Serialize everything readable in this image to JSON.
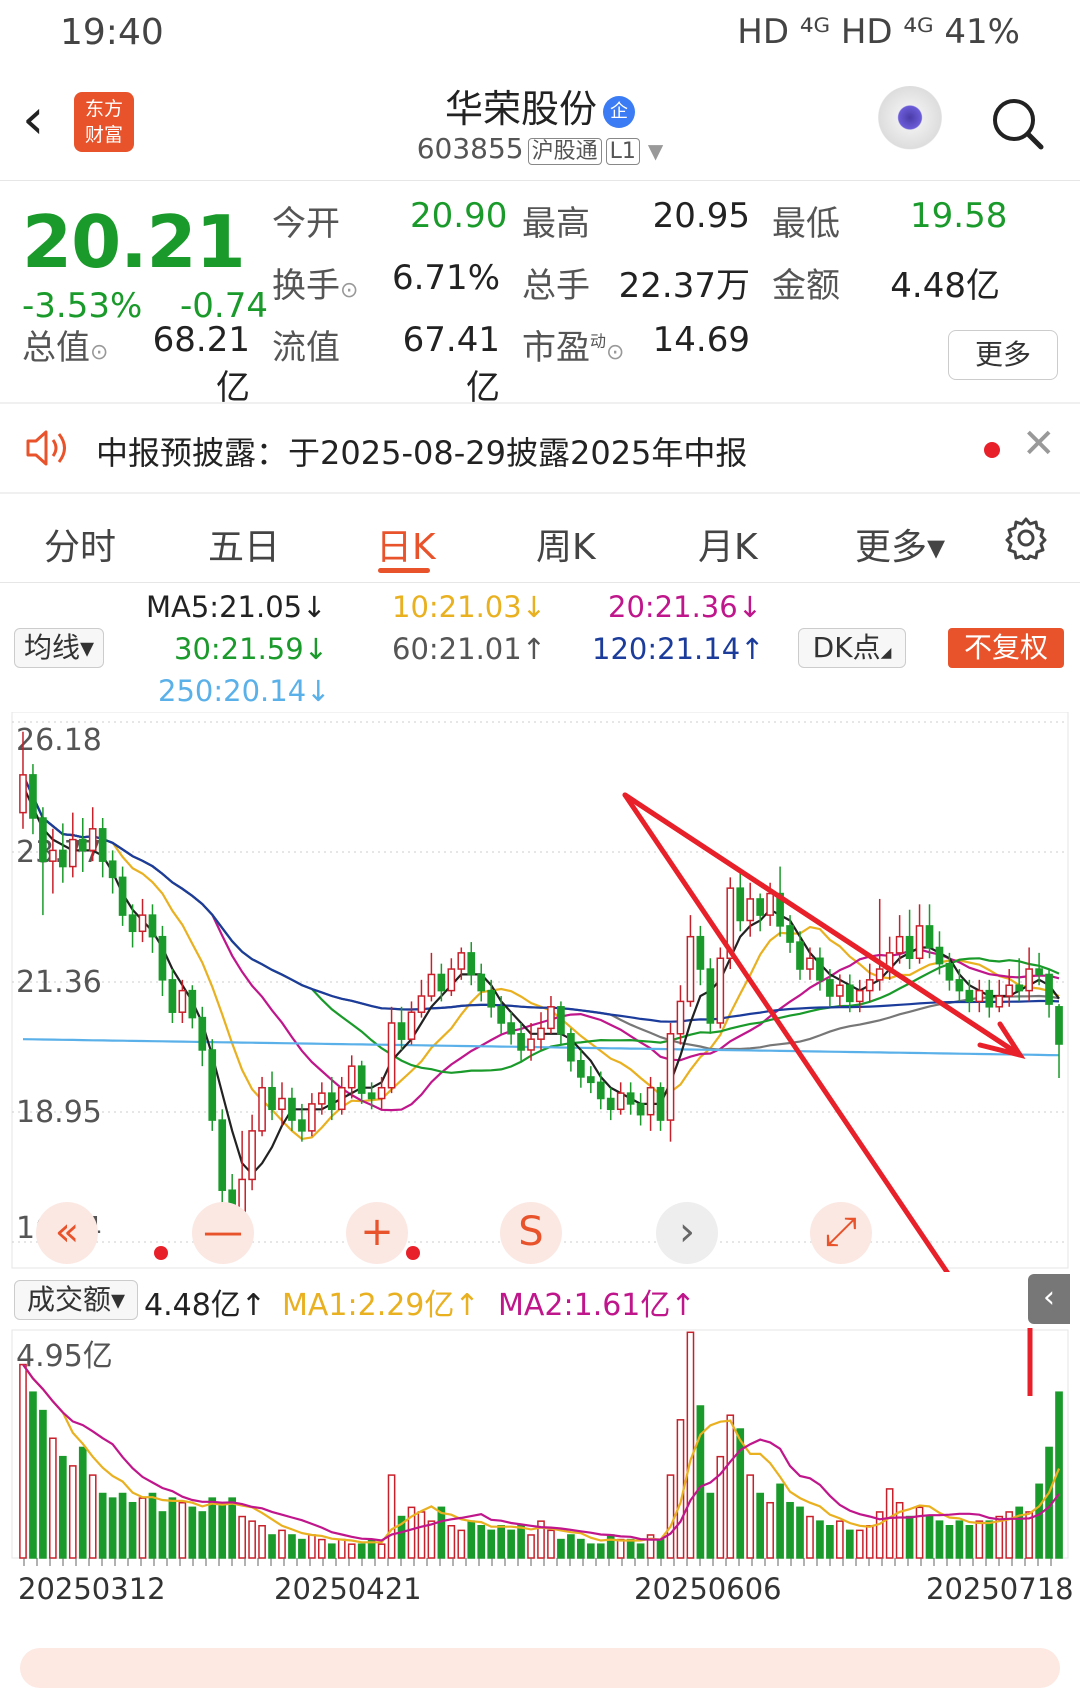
{
  "status_bar": {
    "time": "19:40",
    "right": "HD ⁴ᴳ HD ⁴ᴳ 41%"
  },
  "header": {
    "logo_text": "东方财富",
    "stock_name": "华荣股份",
    "enterprise_badge": "企",
    "code": "603855",
    "tag1": "沪股通",
    "tag2": "L1"
  },
  "quote": {
    "price": "20.21",
    "change_pct": "-3.53%",
    "change_amt": "-0.74",
    "open_label": "今开",
    "open": "20.90",
    "high_label": "最高",
    "high": "20.95",
    "low_label": "最低",
    "low": "19.58",
    "turnover_label": "换手",
    "turnover": "6.71%",
    "volume_label": "总手",
    "volume": "22.37万",
    "amount_label": "金额",
    "amount": "4.48亿",
    "mcap_label": "总值",
    "mcap": "68.21亿",
    "float_label": "流值",
    "float": "67.41亿",
    "pe_label": "市盈",
    "pe_sup": "动",
    "pe": "14.69",
    "more_button": "更多"
  },
  "notice": {
    "text": "中报预披露：于2025-08-29披露2025年中报"
  },
  "tabs": [
    "分时",
    "五日",
    "日K",
    "周K",
    "月K",
    "更多▾"
  ],
  "active_tab": "日K",
  "ma_legend": {
    "selector": "均线▾",
    "ma5": "MA5:21.05↓",
    "ma10": "10:21.03↓",
    "ma20": "20:21.36↓",
    "ma30": "30:21.59↓",
    "ma60": "60:21.01↑",
    "ma120": "120:21.14↑",
    "ma250": "250:20.14↓",
    "dk_button": "DK点",
    "fq_button": "不复权"
  },
  "colors": {
    "up": "#c8202a",
    "down": "#1a9a2a",
    "accent": "#e8532b",
    "ma5": "#222222",
    "ma10": "#e9b020",
    "ma20": "#c0168c",
    "ma30": "#1a9a2a",
    "ma60": "#777777",
    "ma120": "#1c3c9c",
    "ma250": "#5ab0e8"
  },
  "price_axis": {
    "labels": [
      "26.18",
      "23.77",
      "21.36",
      "18.95",
      "16.54"
    ]
  },
  "controls": [
    "«",
    "—",
    "+",
    "S",
    "›",
    "⤢"
  ],
  "volume_legend": {
    "selector": "成交额▾",
    "value": "4.48亿↑",
    "ma1": "MA1:2.29亿↑",
    "ma2": "MA2:1.61亿↑",
    "axis_label": "4.95亿"
  },
  "dates": [
    "20250312",
    "20250421",
    "20250606",
    "20250718"
  ],
  "chart_data": {
    "type": "candlestick",
    "ylim": [
      16.54,
      26.18
    ],
    "volume_ylim": [
      0,
      4.95
    ],
    "candles": [
      [
        24.5,
        25.2,
        26.0,
        24.2
      ],
      [
        25.2,
        24.4,
        25.4,
        24.1
      ],
      [
        24.4,
        23.6,
        24.6,
        22.6
      ],
      [
        23.6,
        23.8,
        24.2,
        23.0
      ],
      [
        23.8,
        23.5,
        24.3,
        23.2
      ],
      [
        23.5,
        24.0,
        24.5,
        23.3
      ],
      [
        24.0,
        23.8,
        24.4,
        23.4
      ],
      [
        23.8,
        24.2,
        24.6,
        23.6
      ],
      [
        24.2,
        23.6,
        24.4,
        23.3
      ],
      [
        23.6,
        23.3,
        23.8,
        23.0
      ],
      [
        23.3,
        22.6,
        23.5,
        22.4
      ],
      [
        22.6,
        22.3,
        22.8,
        22.0
      ],
      [
        22.3,
        22.6,
        22.9,
        22.1
      ],
      [
        22.6,
        22.2,
        22.8,
        21.9
      ],
      [
        22.2,
        21.4,
        22.4,
        21.1
      ],
      [
        21.4,
        20.8,
        21.6,
        20.6
      ],
      [
        20.8,
        21.2,
        21.4,
        20.6
      ],
      [
        21.2,
        20.7,
        21.3,
        20.5
      ],
      [
        20.7,
        20.1,
        20.9,
        19.8
      ],
      [
        20.1,
        18.8,
        20.3,
        18.6
      ],
      [
        18.8,
        17.5,
        19.0,
        17.2
      ],
      [
        17.5,
        16.9,
        17.8,
        16.54
      ],
      [
        16.9,
        17.7,
        18.6,
        16.54
      ],
      [
        17.7,
        18.6,
        18.9,
        17.5
      ],
      [
        18.6,
        19.4,
        19.6,
        18.5
      ],
      [
        19.4,
        19.0,
        19.7,
        18.8
      ],
      [
        19.0,
        19.2,
        19.5,
        18.7
      ],
      [
        19.2,
        18.8,
        19.4,
        18.6
      ],
      [
        18.8,
        18.6,
        19.1,
        18.4
      ],
      [
        18.6,
        19.1,
        19.3,
        18.5
      ],
      [
        19.1,
        19.3,
        19.5,
        18.9
      ],
      [
        19.3,
        19.0,
        19.6,
        18.8
      ],
      [
        19.0,
        19.4,
        19.6,
        18.9
      ],
      [
        19.4,
        19.8,
        20.0,
        19.2
      ],
      [
        19.8,
        19.3,
        19.9,
        19.1
      ],
      [
        19.3,
        19.2,
        19.5,
        19.0
      ],
      [
        19.2,
        19.4,
        19.6,
        19.0
      ],
      [
        19.4,
        20.6,
        20.9,
        19.3
      ],
      [
        20.6,
        20.3,
        20.9,
        20.1
      ],
      [
        20.3,
        20.8,
        21.0,
        20.2
      ],
      [
        20.8,
        21.1,
        21.4,
        20.7
      ],
      [
        21.1,
        21.5,
        21.9,
        21.0
      ],
      [
        21.5,
        21.2,
        21.7,
        21.0
      ],
      [
        21.2,
        21.6,
        21.8,
        21.1
      ],
      [
        21.6,
        21.9,
        22.0,
        21.4
      ],
      [
        21.9,
        21.5,
        22.1,
        21.3
      ],
      [
        21.5,
        21.2,
        21.7,
        21.0
      ],
      [
        21.2,
        20.9,
        21.4,
        20.7
      ],
      [
        20.9,
        20.6,
        21.1,
        20.4
      ],
      [
        20.6,
        20.4,
        20.8,
        20.2
      ],
      [
        20.4,
        20.1,
        20.6,
        19.9
      ],
      [
        20.1,
        20.3,
        20.6,
        19.9
      ],
      [
        20.3,
        20.5,
        20.8,
        20.1
      ],
      [
        20.5,
        20.9,
        21.1,
        20.4
      ],
      [
        20.9,
        20.4,
        21.0,
        20.2
      ],
      [
        20.4,
        19.9,
        20.5,
        19.7
      ],
      [
        19.9,
        19.6,
        20.1,
        19.4
      ],
      [
        19.6,
        19.5,
        19.8,
        19.3
      ],
      [
        19.5,
        19.2,
        19.7,
        19.0
      ],
      [
        19.2,
        19.0,
        19.4,
        18.8
      ],
      [
        19.0,
        19.3,
        19.5,
        18.9
      ],
      [
        19.3,
        19.1,
        19.5,
        18.9
      ],
      [
        19.1,
        18.9,
        19.3,
        18.7
      ],
      [
        18.9,
        19.4,
        19.6,
        18.6
      ],
      [
        19.4,
        18.8,
        19.5,
        18.6
      ],
      [
        18.8,
        20.4,
        20.6,
        18.4
      ],
      [
        20.4,
        21.0,
        21.3,
        20.2
      ],
      [
        21.0,
        22.2,
        22.6,
        20.9
      ],
      [
        22.2,
        21.6,
        22.4,
        21.3
      ],
      [
        21.6,
        20.6,
        21.8,
        20.4
      ],
      [
        20.6,
        21.8,
        22.0,
        20.5
      ],
      [
        21.8,
        23.1,
        23.3,
        21.6
      ],
      [
        23.1,
        22.5,
        23.4,
        22.3
      ],
      [
        22.5,
        22.9,
        23.2,
        22.2
      ],
      [
        22.9,
        22.6,
        23.0,
        22.3
      ],
      [
        22.6,
        23.0,
        23.2,
        22.4
      ],
      [
        23.0,
        22.4,
        23.5,
        22.2
      ],
      [
        22.4,
        22.1,
        22.6,
        21.9
      ],
      [
        22.1,
        21.6,
        22.3,
        21.4
      ],
      [
        21.6,
        21.8,
        22.0,
        21.4
      ],
      [
        21.8,
        21.4,
        22.0,
        21.2
      ],
      [
        21.4,
        21.1,
        21.6,
        20.9
      ],
      [
        21.1,
        21.3,
        21.5,
        20.9
      ],
      [
        21.3,
        21.0,
        21.5,
        20.8
      ],
      [
        21.0,
        21.2,
        21.4,
        20.8
      ],
      [
        21.2,
        21.4,
        21.7,
        21.0
      ],
      [
        21.4,
        21.6,
        22.9,
        21.2
      ],
      [
        21.6,
        21.9,
        22.2,
        21.4
      ],
      [
        21.9,
        22.2,
        22.6,
        21.7
      ],
      [
        22.2,
        21.8,
        22.7,
        21.6
      ],
      [
        21.8,
        22.4,
        22.8,
        21.7
      ],
      [
        22.4,
        22.0,
        22.8,
        21.8
      ],
      [
        22.0,
        21.7,
        22.3,
        21.5
      ],
      [
        21.7,
        21.4,
        21.9,
        21.2
      ],
      [
        21.4,
        21.2,
        21.6,
        21.0
      ],
      [
        21.2,
        21.0,
        21.4,
        20.8
      ],
      [
        21.0,
        21.2,
        21.4,
        20.8
      ],
      [
        21.2,
        20.9,
        21.4,
        20.7
      ],
      [
        20.9,
        21.1,
        21.4,
        20.8
      ],
      [
        21.1,
        21.3,
        21.6,
        20.9
      ],
      [
        21.3,
        21.2,
        21.8,
        21.0
      ],
      [
        21.2,
        21.6,
        22.0,
        21.0
      ],
      [
        21.6,
        21.5,
        21.9,
        21.3
      ],
      [
        21.5,
        20.95,
        21.6,
        20.7
      ],
      [
        20.9,
        20.21,
        20.95,
        19.58
      ]
    ],
    "volumes": [
      4.2,
      3.6,
      3.2,
      2.6,
      2.2,
      2.0,
      2.4,
      1.8,
      1.4,
      1.3,
      1.4,
      1.2,
      1.3,
      1.4,
      1.0,
      1.3,
      1.2,
      1.1,
      1.0,
      1.3,
      1.2,
      1.3,
      0.9,
      0.8,
      0.7,
      0.5,
      0.6,
      0.5,
      0.4,
      0.5,
      0.4,
      0.3,
      0.4,
      0.3,
      0.3,
      0.4,
      0.3,
      1.8,
      0.9,
      1.1,
      1.0,
      0.8,
      1.1,
      0.7,
      0.6,
      0.8,
      0.7,
      0.6,
      0.7,
      0.6,
      0.7,
      0.5,
      0.8,
      0.6,
      0.4,
      0.5,
      0.4,
      0.3,
      0.3,
      0.5,
      0.4,
      0.4,
      0.3,
      0.5,
      0.4,
      1.8,
      3.0,
      4.9,
      3.3,
      1.4,
      2.2,
      3.1,
      2.8,
      1.8,
      1.4,
      1.2,
      1.6,
      1.2,
      1.1,
      0.9,
      0.8,
      0.7,
      0.8,
      0.6,
      0.6,
      0.7,
      1.0,
      1.5,
      1.2,
      0.9,
      1.1,
      0.9,
      0.8,
      0.7,
      0.8,
      0.7,
      0.8,
      0.8,
      0.9,
      1.0,
      1.1,
      1.0,
      1.6,
      2.4,
      3.6
    ],
    "ma_lines": {
      "MA5": [
        25.0,
        24.6,
        24.2,
        24.0,
        23.9,
        23.8,
        23.8,
        23.8,
        23.7,
        23.4,
        23.0,
        22.7,
        22.5,
        22.3,
        22.0,
        21.6,
        21.3,
        21.0,
        20.6,
        20.0,
        19.3,
        18.6,
        18.0,
        17.8,
        18.0,
        18.3,
        18.7,
        19.0,
        19.0,
        19.0,
        19.0,
        19.1,
        19.2,
        19.3,
        19.4,
        19.4,
        19.5,
        19.9,
        20.1,
        20.3,
        20.6,
        20.9,
        21.1,
        21.3,
        21.5,
        21.5,
        21.5,
        21.3,
        21.0,
        20.8,
        20.6,
        20.4,
        20.4,
        20.4,
        20.4,
        20.3,
        20.1,
        19.9,
        19.6,
        19.4,
        19.3,
        19.2,
        19.1,
        19.1,
        19.1,
        19.5,
        20.0,
        20.6,
        21.1,
        21.2,
        21.4,
        21.8,
        22.2,
        22.4,
        22.5,
        22.7,
        22.6,
        22.5,
        22.2,
        21.9,
        21.7,
        21.5,
        21.4,
        21.3,
        21.2,
        21.3,
        21.4,
        21.6,
        21.8,
        21.9,
        22.0,
        22.0,
        21.9,
        21.8,
        21.5,
        21.3,
        21.2,
        21.1,
        21.1,
        21.1,
        21.2,
        21.3,
        21.4,
        21.3,
        21.05
      ]
    }
  }
}
